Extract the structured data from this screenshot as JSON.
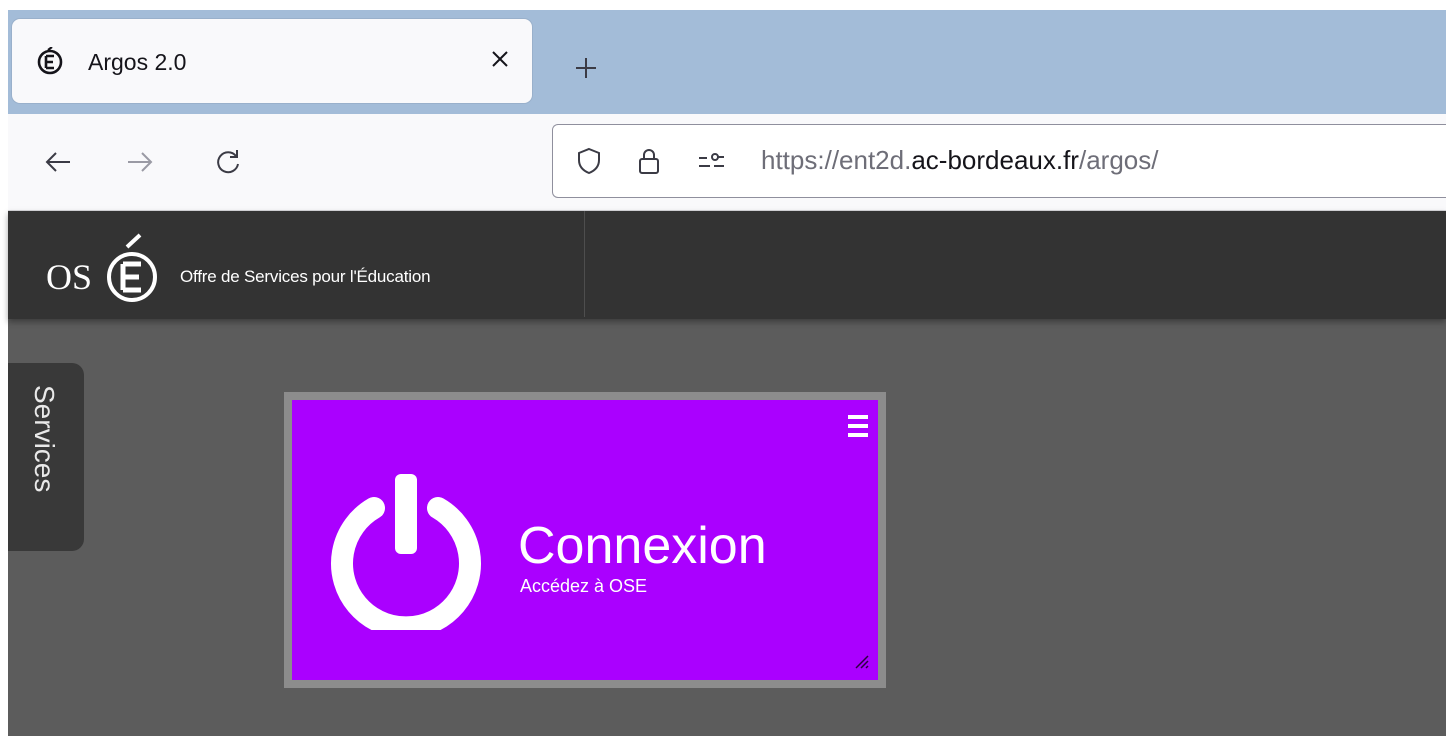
{
  "browser": {
    "tab": {
      "title": "Argos 2.0",
      "favicon": "ose-e-icon",
      "close_icon": "close-icon"
    },
    "new_tab_icon": "plus-icon",
    "nav": {
      "back_icon": "arrow-left-icon",
      "forward_icon": "arrow-right-icon",
      "reload_icon": "reload-icon"
    },
    "urlbar": {
      "shield_icon": "shield-icon",
      "lock_icon": "lock-icon",
      "permissions_icon": "permissions-icon",
      "url_prefix": "https://ent2d.",
      "url_domain": "ac-bordeaux.fr",
      "url_path": "/argos/"
    }
  },
  "header": {
    "logo_text": "OSÉ",
    "tagline": "Offre de Services pour l'Éducation"
  },
  "sidebar": {
    "services_label": "Services"
  },
  "tile": {
    "title": "Connexion",
    "subtitle": "Accédez à OSE",
    "icon": "power-icon",
    "menu_icon": "hamburger-menu-icon",
    "resize_icon": "resize-handle-icon",
    "color": "#aa00ff"
  },
  "colors": {
    "tabstrip": "#a3bcd8",
    "topbar": "#333333",
    "page_bg": "#5c5c5c",
    "tile_frame": "#8c8c8c"
  }
}
